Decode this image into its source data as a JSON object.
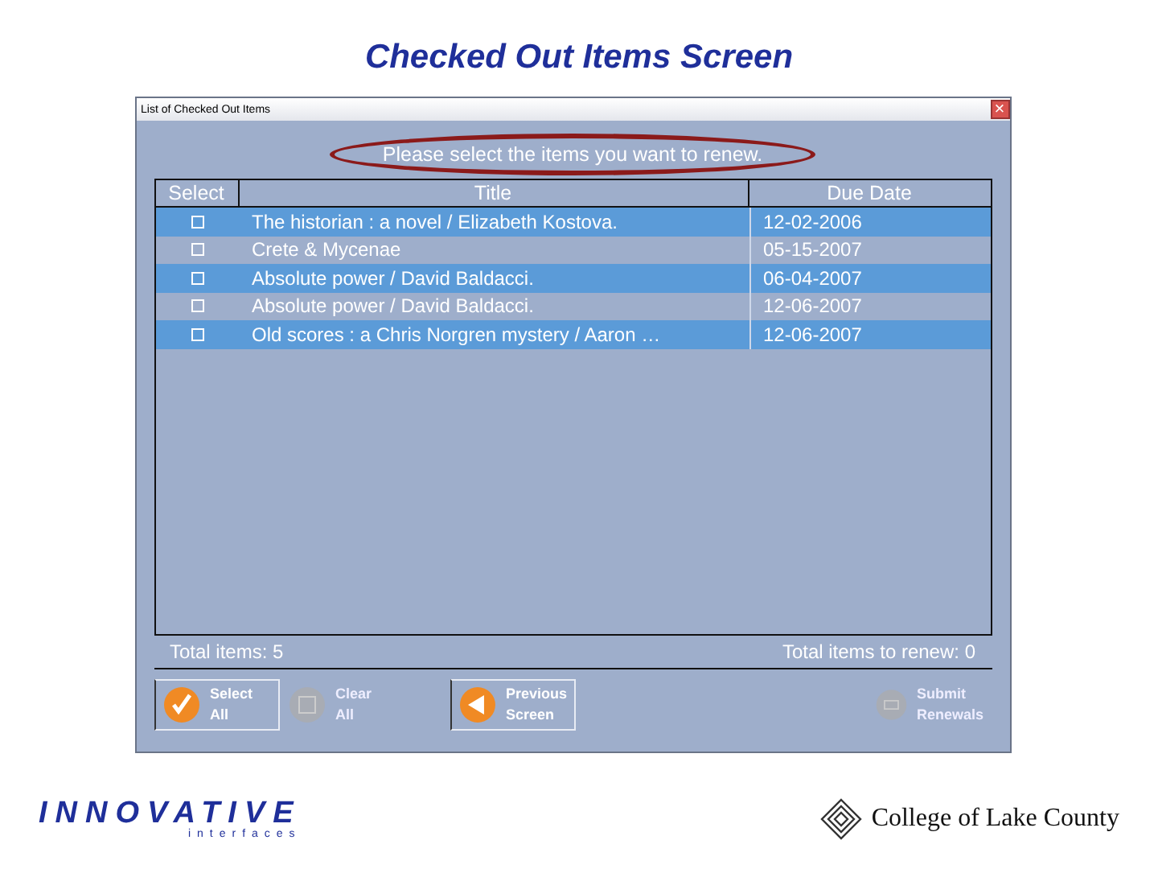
{
  "slide_title": "Checked Out Items Screen",
  "window": {
    "title": "List of Checked Out Items",
    "close": "×"
  },
  "instruction": "Please select the items you want to renew.",
  "table": {
    "columns": [
      "Select",
      "Title",
      "Due Date"
    ],
    "rows": [
      {
        "title": "The historian : a novel / Elizabeth Kostova.",
        "due": "12-02-2006",
        "checked": false,
        "selected": true
      },
      {
        "title": "Crete & Mycenae",
        "due": "05-15-2007",
        "checked": false,
        "selected": false
      },
      {
        "title": "Absolute power / David Baldacci.",
        "due": "06-04-2007",
        "checked": false,
        "selected": true
      },
      {
        "title": "Absolute power / David Baldacci.",
        "due": "12-06-2007",
        "checked": false,
        "selected": false
      },
      {
        "title": "Old scores : a Chris Norgren mystery / Aaron …",
        "due": "12-06-2007",
        "checked": false,
        "selected": true
      }
    ]
  },
  "totals": {
    "items": "Total items: 5",
    "to_renew": "Total items to renew: 0"
  },
  "buttons": [
    {
      "line1": "Select",
      "line2": "All",
      "kind": "check",
      "disabled": false
    },
    {
      "line1": "Clear",
      "line2": "All",
      "kind": "clear",
      "disabled": true
    },
    {
      "line1": "Previous",
      "line2": "Screen",
      "kind": "back",
      "disabled": false
    },
    {
      "line1": "Submit",
      "line2": "Renewals",
      "kind": "submit",
      "disabled": true
    }
  ],
  "footer": {
    "left_logo": "INNOVATIVE",
    "left_sub": "interfaces",
    "right_logo": "College of Lake County"
  }
}
